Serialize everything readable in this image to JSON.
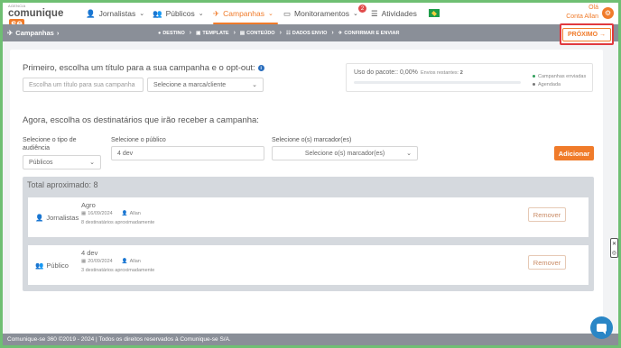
{
  "brand": {
    "tag": "AGENCIA",
    "word": "comunique",
    "suffix": "se"
  },
  "nav": {
    "items": [
      {
        "label": "Jornalistas",
        "icon": "user-icon"
      },
      {
        "label": "Públicos",
        "icon": "users-icon"
      },
      {
        "label": "Campanhas",
        "icon": "send-icon",
        "active": true
      },
      {
        "label": "Monitoramentos",
        "icon": "monitor-icon",
        "badge": "2"
      },
      {
        "label": "Atividades",
        "icon": "list-icon"
      }
    ],
    "user_greeting": "Olá",
    "user_name": "Conta Allan"
  },
  "stepbar": {
    "crumb": "Campanhas",
    "steps": [
      "DESTINO",
      "TEMPLATE",
      "CONTEÚDO",
      "DADOS ENVIO",
      "CONFIRMAR E ENVIAR"
    ],
    "active_step": "DESTINO",
    "next_label": "PRÓXIMO →"
  },
  "section1": {
    "title": "Primeiro, escolha um título para a sua campanha e o opt-out:",
    "title_placeholder": "Escolha um título para sua campanha",
    "brand_select": "Selecione a marca/cliente"
  },
  "usage": {
    "label": "Uso do pacote:: 0,00%",
    "remaining": "Envios restantes:",
    "remaining_value": "2",
    "progress": 0,
    "legend": [
      "Campanhas enviadas",
      "Agendada"
    ],
    "legend_colors": [
      "#2e9e5a",
      "#777777"
    ]
  },
  "section2": {
    "title": "Agora, escolha os destinatários que irão receber a campanha:",
    "type_label": "Selecione o tipo de audiência",
    "type_value": "Públicos",
    "public_label": "Selecione o público",
    "public_value": "4 dev",
    "marker_label": "Selecione o(s) marcador(es)",
    "marker_value": "Selecione o(s) marcador(es)",
    "add_button": "Adicionar"
  },
  "results": {
    "total": "Total aproximado: 8",
    "rows": [
      {
        "type": "Jornalistas",
        "title": "Agro",
        "date": "16/09/2024",
        "owner": "Allan",
        "count": "8 destinatários aproximadamente",
        "remove": "Remover"
      },
      {
        "type": "Público",
        "title": "4 dev",
        "date": "20/09/2024",
        "owner": "Allan",
        "count": "3 destinatários aproximadamente",
        "remove": "Remover"
      }
    ]
  },
  "footer": "Comunique-se 360 ©2019 - 2024 | Todos os direitos reservados à Comunique-se S/A.",
  "colors": {
    "accent": "#f07b2a",
    "bar": "#8a8f98",
    "highlight": "#e0393e"
  }
}
